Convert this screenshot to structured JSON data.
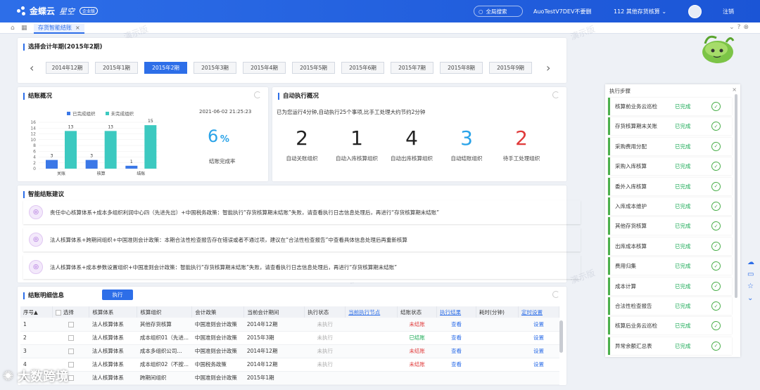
{
  "header": {
    "brand": "金蝶云",
    "product": "星空",
    "edition": "企业版",
    "search": "全局搜索",
    "org": "AuoTestV7DEV不要删",
    "account": "112 其他存货核算",
    "logout": "注销"
  },
  "tab": {
    "label": "存货智能结账",
    "close": "×"
  },
  "period_card": {
    "title": "选择会计年期(2015年2期)",
    "prev": "‹",
    "next": "›",
    "periods": [
      "2014年12期",
      "2015年1期",
      "2015年2期",
      "2015年3期",
      "2015年4期",
      "2015年5期",
      "2015年6期",
      "2015年7期",
      "2015年8期",
      "2015年9期"
    ],
    "active_index": 2
  },
  "overview": {
    "title": "结账概况",
    "legend_done": "已完成组织",
    "legend_undone": "未完成组织",
    "timestamp": "2021-06-02 21:25:23",
    "rate_value": "6",
    "rate_unit": "%",
    "rate_label": "结账完成率"
  },
  "chart_data": {
    "type": "bar",
    "categories": [
      "关账",
      "核算",
      "结账"
    ],
    "ylim": [
      0,
      16
    ],
    "yticks": [
      "0",
      "2",
      "4",
      "6",
      "8",
      "10",
      "12",
      "14",
      "16"
    ],
    "series": [
      {
        "name": "已完成组织",
        "values": [
          3,
          3,
          1
        ],
        "color": "#3b78e7"
      },
      {
        "name": "未完成组织",
        "values": [
          13,
          13,
          15
        ],
        "color": "#3cc9c0"
      }
    ]
  },
  "auto": {
    "title": "自动执行概况",
    "summary": "已为您运行4分钟,自动执行25个事项,比手工处理大约节约2分钟",
    "stats": [
      {
        "num": "2",
        "label": "自动关账组织",
        "color": "#222"
      },
      {
        "num": "1",
        "label": "自动入库核算组织",
        "color": "#222"
      },
      {
        "num": "4",
        "label": "自动出库核算组织",
        "color": "#222"
      },
      {
        "num": "3",
        "label": "自动结账组织",
        "color": "#2aa3e8"
      },
      {
        "num": "2",
        "label": "待手工处理组织",
        "color": "#e03a3a"
      }
    ]
  },
  "suggest": {
    "title": "智能结账建议",
    "items": [
      "责任中心核算体系+成本多组织利润中心四（先进先出）+中国税务政策：智能执行“存货核算期末结账”失败，请查看执行日志信息处理后，再进行“存货核算期末结账”",
      "法人核算体系+跨期间组织+中国准则会计政策：本期合法性检查报告存在错误或者不通过项，建议在“合法性检查报告”中查看具体信息处理后再重新核算",
      "法人核算体系+成本参数设置组织+中国准则会计政策：智能执行“存货核算期末结账”失败，请查看执行日志信息处理后，再进行“存货核算期末结账”"
    ]
  },
  "detail": {
    "title": "结账明细信息",
    "exec": "执行",
    "columns": [
      "序号▲",
      "选择",
      "核算体系",
      "核算组织",
      "会计政策",
      "当前会计期间",
      "执行状态",
      "当前执行节点",
      "结账状态",
      "执行结果",
      "耗时(分钟)",
      "定时设置"
    ],
    "rows": [
      [
        "1",
        "",
        "法人核算体系",
        "其他存货核算",
        "中国准则会计政策",
        "2014年12期",
        "未执行",
        "",
        "未结账",
        "查看",
        "",
        "设置"
      ],
      [
        "2",
        "",
        "法人核算体系",
        "成本组织01（先进...",
        "中国准则会计政策",
        "2015年3期",
        "未执行",
        "",
        "已结账",
        "查看",
        "",
        "设置"
      ],
      [
        "3",
        "",
        "法人核算体系",
        "成本多组织公司...",
        "中国准则会计政策",
        "2014年12期",
        "未执行",
        "",
        "未结账",
        "查看",
        "",
        "设置"
      ],
      [
        "4",
        "",
        "法人核算体系",
        "成本组织02（不按...",
        "中国税务政策",
        "2014年12期",
        "未执行",
        "",
        "未结账",
        "查看",
        "",
        "设置"
      ],
      [
        "5",
        "",
        "法人核算体系",
        "跨期间组织",
        "中国准则会计政策",
        "2015年1期",
        "",
        "",
        "",
        "",
        "",
        ""
      ]
    ]
  },
  "steps": {
    "title": "执行步骤",
    "close": "×",
    "items": [
      {
        "name": "核算前业务云巡检",
        "status": "已完成"
      },
      {
        "name": "存货核算期末关账",
        "status": "已完成"
      },
      {
        "name": "采购费用分配",
        "status": "已完成"
      },
      {
        "name": "采购入库核算",
        "status": "已完成"
      },
      {
        "name": "委外入库核算",
        "status": "已完成"
      },
      {
        "name": "入库成本维护",
        "status": "已完成"
      },
      {
        "name": "其他存货核算",
        "status": "已完成"
      },
      {
        "name": "出库成本核算",
        "status": "已完成"
      },
      {
        "name": "费用归集",
        "status": "已完成"
      },
      {
        "name": "成本计算",
        "status": "已完成"
      },
      {
        "name": "合法性检查报告",
        "status": "已完成"
      },
      {
        "name": "核算后业务云巡检",
        "status": "已完成"
      },
      {
        "name": "异常余额汇总表",
        "status": "已完成"
      }
    ]
  },
  "watermark": "演示版",
  "brand_watermark": "大数跨境"
}
